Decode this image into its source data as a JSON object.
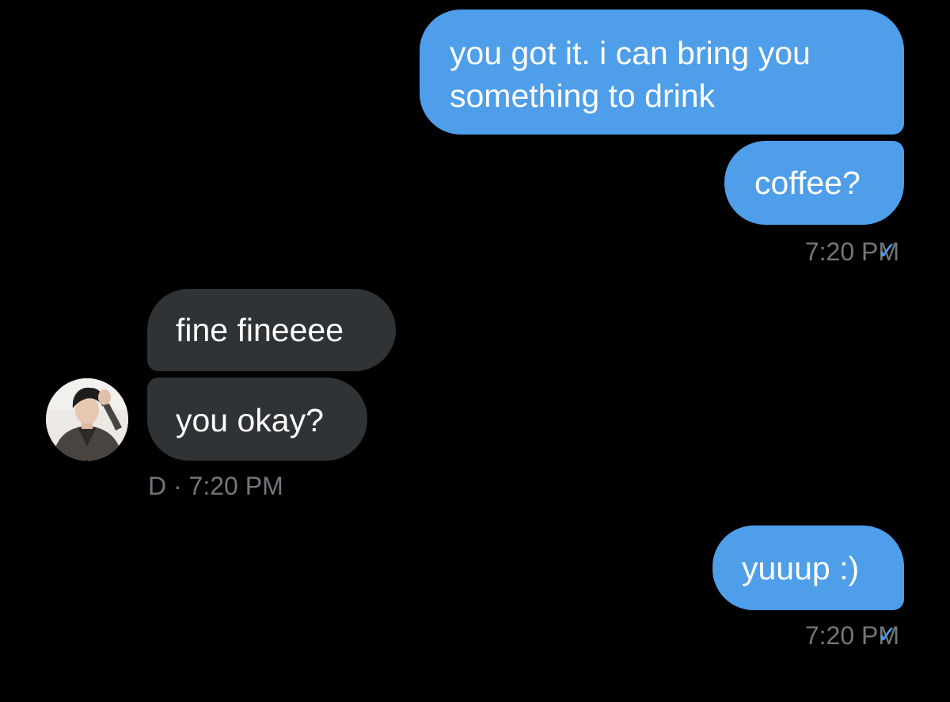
{
  "conversation": {
    "messages": [
      {
        "direction": "outgoing",
        "text": "you got it. i can bring you\nsomething to drink"
      },
      {
        "direction": "outgoing",
        "text": "coffee?"
      },
      {
        "direction": "incoming",
        "text": "fine fineeee"
      },
      {
        "direction": "incoming",
        "text": "you okay?"
      },
      {
        "direction": "outgoing",
        "text": "yuuup :)"
      }
    ],
    "meta": [
      {
        "text": "7:20 PM",
        "read_icon": "✓"
      },
      {
        "text": "D · 7:20 PM"
      },
      {
        "text": "7:20 PM",
        "read_icon": "✓"
      }
    ]
  },
  "avatar": {
    "icon": "user-avatar-photo"
  },
  "colors": {
    "background": "#000000",
    "outgoing_bubble": "#4e9ee9",
    "incoming_bubble": "#2f3336",
    "meta_text": "#71767b",
    "read_check": "#4e9ee9"
  }
}
